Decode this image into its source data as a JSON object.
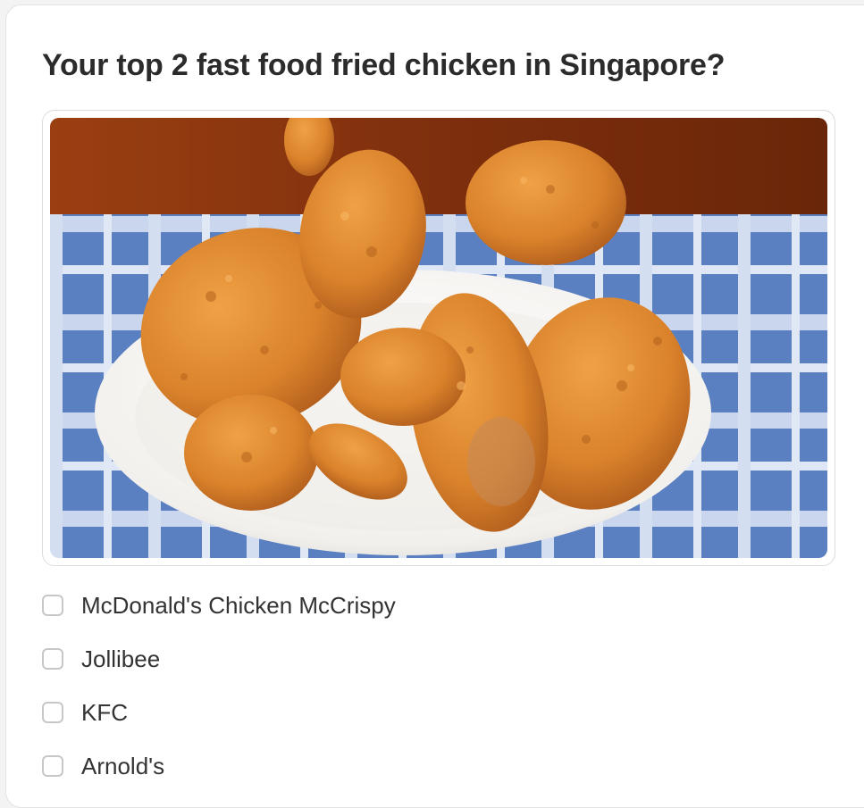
{
  "question": {
    "title": "Your top 2 fast food fried chicken in Singapore?",
    "image_description_icon": "fried-chicken-photo"
  },
  "options": [
    {
      "label": "McDonald's Chicken McCrispy",
      "checked": false
    },
    {
      "label": "Jollibee",
      "checked": false
    },
    {
      "label": "KFC",
      "checked": false
    },
    {
      "label": "Arnold's",
      "checked": false
    }
  ],
  "colors": {
    "title": "#2b2b2b",
    "option_text": "#333333",
    "checkbox_border": "#c7c7c7",
    "card_border": "#e3e3e3",
    "chicken": "#d9822b",
    "tablecloth": "#5a7fc0",
    "table_wood": "#8a3a12"
  }
}
